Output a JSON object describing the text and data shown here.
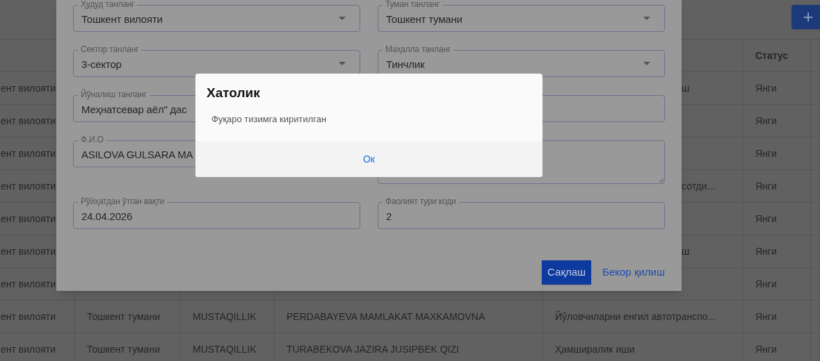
{
  "page": {
    "add_button": "+",
    "table": {
      "header": {
        "status": "Статус"
      },
      "rows": [
        {
          "region": "ент вилояти",
          "activity_fragment": "ш",
          "status": "Янги"
        },
        {
          "region": "ент вилояти",
          "status": "Янги"
        },
        {
          "region": "ент вилояти",
          "status": "Янги"
        },
        {
          "region": "ент вилояти",
          "activity_fragment": "сотди...",
          "status": "Янги"
        },
        {
          "region": "ент вилояти",
          "status": "Янги"
        },
        {
          "region": "ент вилояти",
          "activity_fragment": "ш",
          "status": "Янги"
        },
        {
          "region": "ент вилояти",
          "status": "Янги"
        },
        {
          "region": "ент вилояти",
          "district": "Тошкент тумани",
          "mahalla": "MUSTAQILLIK",
          "name": "PERDABAYEVA MAMLAKAT MAXKAMOVNA",
          "activity": "Йўловчиларни енгил автотранспо...",
          "status": "Янги"
        },
        {
          "region": "ент вилояти",
          "district": "Тошкент тумани",
          "mahalla": "MUSTAQILLIK",
          "name": "TURABEKOVA JAZIRA JUSIPBEK QIZI",
          "activity": "Ҳамширалик иши",
          "status": "Янги"
        }
      ]
    }
  },
  "form_dialog": {
    "fields": [
      {
        "kind": "select",
        "label": "Ҳудуд танланг",
        "value": "Тошкент вилояти"
      },
      {
        "kind": "select",
        "label": "Туман танланг",
        "value": "Тошкент тумани"
      },
      {
        "kind": "select",
        "label": "Сектор танланг",
        "value": "3-сектор"
      },
      {
        "kind": "select",
        "label": "Маҳалла танланг",
        "value": "Тинчлик"
      },
      {
        "kind": "text",
        "label": "Йўналиш танланг",
        "value": "Меҳнатсевар аёл\" дас"
      },
      {
        "kind": "text"
      },
      {
        "kind": "text",
        "label": "Ф.И.О",
        "value": "ASILOVA GULSARA MA"
      },
      {
        "kind": "textarea"
      },
      {
        "kind": "text",
        "label": "Рўйҳатдан ўтган вақти",
        "value": "24.04.2026"
      },
      {
        "kind": "text",
        "label": "Фаолият тури коди",
        "value": "2"
      }
    ],
    "save_button": "Сақлаш",
    "cancel_button": "Бекор қилиш"
  },
  "alert": {
    "title": "Хатолик",
    "message": "Фуқаро тизимга киритилган",
    "ok_button": "Ок"
  }
}
